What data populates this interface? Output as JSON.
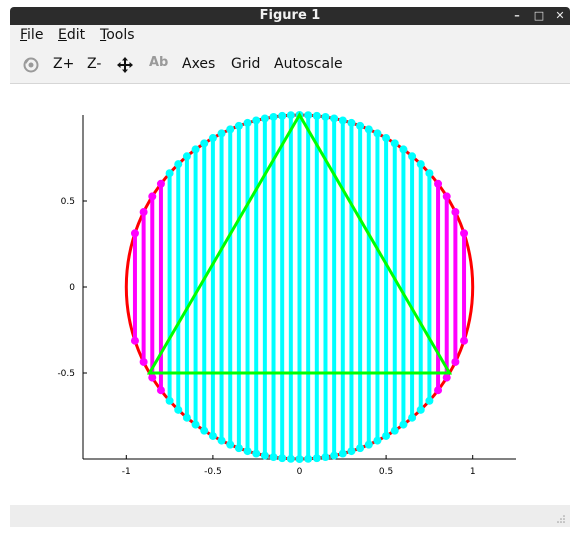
{
  "window": {
    "title": "Figure 1",
    "controls": {
      "minimize": "–",
      "maximize": "□",
      "close": "✕"
    }
  },
  "menubar": {
    "items": [
      {
        "accel": "F",
        "rest": "ile"
      },
      {
        "accel": "E",
        "rest": "dit"
      },
      {
        "accel": "T",
        "rest": "ools"
      }
    ]
  },
  "toolbar": {
    "rotate_icon": "rotate-icon",
    "zoom_in": "Z+",
    "zoom_out": "Z-",
    "pan_icon": "pan-icon",
    "text_icon": "Ab",
    "axes": "Axes",
    "grid": "Grid",
    "autoscale": "Autoscale"
  },
  "chart_data": {
    "type": "line",
    "xlim": [
      -1.25,
      1.25
    ],
    "ylim": [
      -1.0,
      1.0
    ],
    "xticks": [
      -1,
      -0.5,
      0,
      0.5,
      1
    ],
    "xtick_labels": [
      "-1",
      "-0.5",
      "0",
      "0.5",
      "1"
    ],
    "yticks": [
      -0.5,
      0,
      0.5
    ],
    "ytick_labels": [
      "-0.5",
      "0",
      "0.5"
    ],
    "grid": false,
    "circle": {
      "center": [
        0,
        0
      ],
      "radius": 1,
      "color": "#ff0000"
    },
    "triangle": {
      "vertices": [
        [
          0,
          1
        ],
        [
          -0.866,
          -0.5
        ],
        [
          0.866,
          -0.5
        ]
      ],
      "color": "#00ff00"
    },
    "chords": {
      "count": 41,
      "x_from": -1,
      "x_to": 1,
      "inside_color": "#00ffff",
      "outside_color": "#ff00ff",
      "note_rule": "vertical chords; cyan where inside triangle span"
    }
  }
}
